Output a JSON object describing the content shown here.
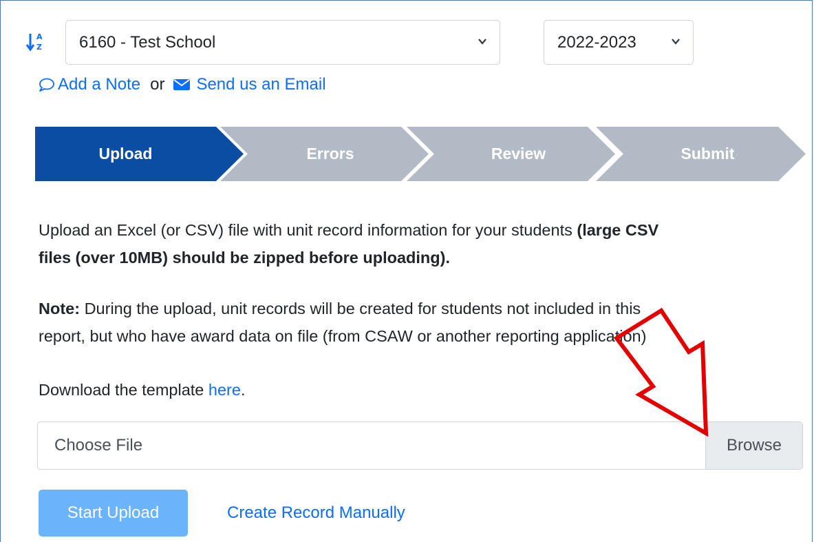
{
  "school_select": {
    "value": "6160 - Test School"
  },
  "year_select": {
    "value": "2022-2023"
  },
  "links": {
    "add_note": "Add a Note",
    "or": "or",
    "send_email": "Send us an Email"
  },
  "steps": [
    "Upload",
    "Errors",
    "Review",
    "Submit"
  ],
  "active_step": "Upload",
  "paragraphs": {
    "intro": "Upload an Excel (or CSV) file with unit record information for your students ",
    "intro_bold_line1": "(large CSV",
    "intro_bold_line2": "files (over 10MB) should be zipped before uploading).",
    "note_label": "Note:",
    "note_line1": " During the upload, unit records will be created for students not included in this",
    "note_line2": "report, but who have award data on file (from CSAW or another reporting application)",
    "template_prefix": "Download the template ",
    "template_link": "here",
    "template_suffix": "."
  },
  "file_input": {
    "placeholder": "Choose File",
    "browse_label": "Browse"
  },
  "buttons": {
    "start_upload": "Start Upload",
    "create_manual": "Create Record Manually"
  },
  "icons": [
    "sort-alpha-icon",
    "chevron-down-icon",
    "chat-icon",
    "envelope-icon",
    "red-arrow-annotation"
  ],
  "colors": {
    "link_blue": "#0d6efd",
    "active_step": "#0b4da2",
    "inactive_step": "#b1bac5",
    "start_button": "#6bb3fb",
    "annotation_red": "#e50000"
  }
}
